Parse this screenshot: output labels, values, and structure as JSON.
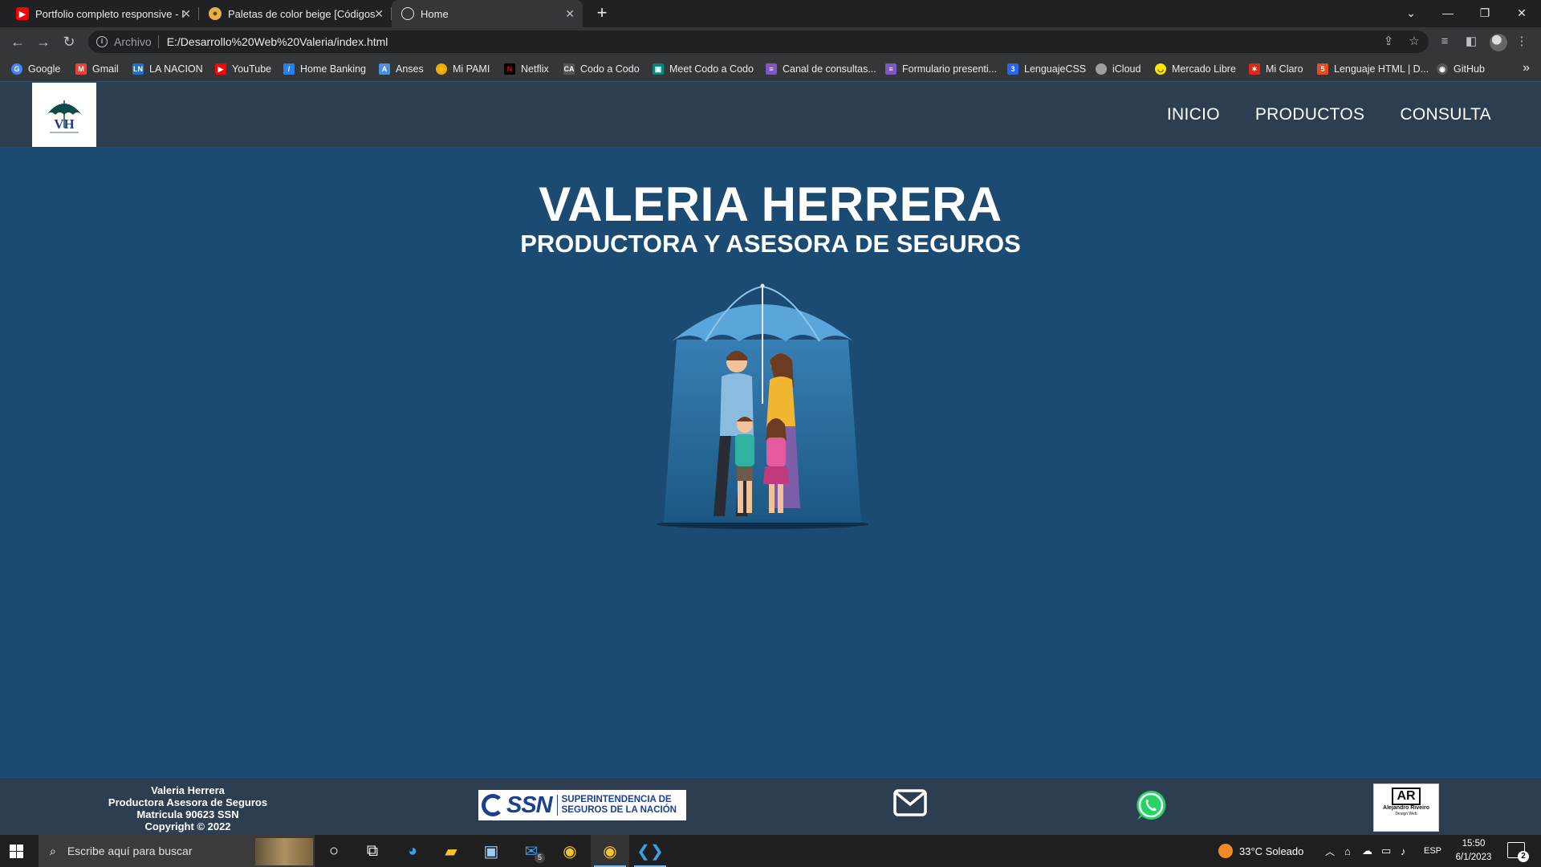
{
  "browser": {
    "tabs": [
      {
        "title": "Portfolio completo responsive - I",
        "icon": "youtube-icon"
      },
      {
        "title": "Paletas de color beige [Códigos",
        "icon": "palette-icon"
      },
      {
        "title": "Home",
        "icon": "globe-icon"
      }
    ],
    "address": {
      "scheme": "Archivo",
      "url": "E:/Desarrollo%20Web%20Valeria/index.html"
    },
    "bookmarks": [
      {
        "label": "Google",
        "icon": "google-icon",
        "color": "#4285f4"
      },
      {
        "label": "Gmail",
        "icon": "gmail-icon",
        "color": "#ea4335"
      },
      {
        "label": "LA NACION",
        "icon": "lanacion-icon",
        "color": "#1a73c8"
      },
      {
        "label": "YouTube",
        "icon": "youtube-icon",
        "color": "#ff0000"
      },
      {
        "label": "Home Banking",
        "icon": "bank-icon",
        "color": "#2b7de9"
      },
      {
        "label": "Anses",
        "icon": "anses-icon",
        "color": "#4a90e2"
      },
      {
        "label": "Mi PAMI",
        "icon": "pami-icon",
        "color": "#f2a900"
      },
      {
        "label": "Netflix",
        "icon": "netflix-icon",
        "color": "#e50914"
      },
      {
        "label": "Codo a Codo",
        "icon": "codo-icon",
        "color": "#555555"
      },
      {
        "label": "Meet Codo a Codo",
        "icon": "meet-icon",
        "color": "#00897b"
      },
      {
        "label": "Canal de consultas...",
        "icon": "list-icon",
        "color": "#7e57c2"
      },
      {
        "label": "Formulario presenti...",
        "icon": "form-icon",
        "color": "#7e57c2"
      },
      {
        "label": "LenguajeCSS",
        "icon": "css-icon",
        "color": "#2965f1"
      },
      {
        "label": "iCloud",
        "icon": "apple-icon",
        "color": "#9e9e9e"
      },
      {
        "label": "Mercado Libre",
        "icon": "mercadolibre-icon",
        "color": "#ffe600"
      },
      {
        "label": "Mi Claro",
        "icon": "claro-icon",
        "color": "#da291c"
      },
      {
        "label": "Lenguaje HTML | D...",
        "icon": "html-icon",
        "color": "#e44d26"
      },
      {
        "label": "GitHub",
        "icon": "github-icon",
        "color": "#cccccc"
      }
    ]
  },
  "site": {
    "logo_text": "VH",
    "nav": [
      "INICIO",
      "PRODUCTOS",
      "CONSULTA"
    ],
    "hero": {
      "title": "VALERIA HERRERA",
      "subtitle": "PRODUCTORA Y ASESORA DE SEGUROS"
    },
    "footer": {
      "lines": [
        "Valeria Herrera",
        "Productora Asesora de Seguros",
        "Matricula 90623 SSN",
        "Copyright © 2022"
      ],
      "ssn_abbr": "SSN",
      "ssn_full_1": "SUPERINTENDENCIA DE",
      "ssn_full_2": "SEGUROS DE LA NACIÓN",
      "designer_logo": "AR",
      "designer_name": "Alejandro Riveiro",
      "designer_role": "Design Web"
    }
  },
  "taskbar": {
    "search_placeholder": "Escribe aquí para buscar",
    "mail_badge": "5",
    "weather": "33°C  Soleado",
    "lang": "ESP",
    "time": "15:50",
    "date": "6/1/2023",
    "notifications": "2"
  },
  "colors": {
    "page_bg": "#1b4b73",
    "header_bg": "#2c3e50",
    "footer_bg": "#2c3e50",
    "whatsapp": "#25d366"
  }
}
